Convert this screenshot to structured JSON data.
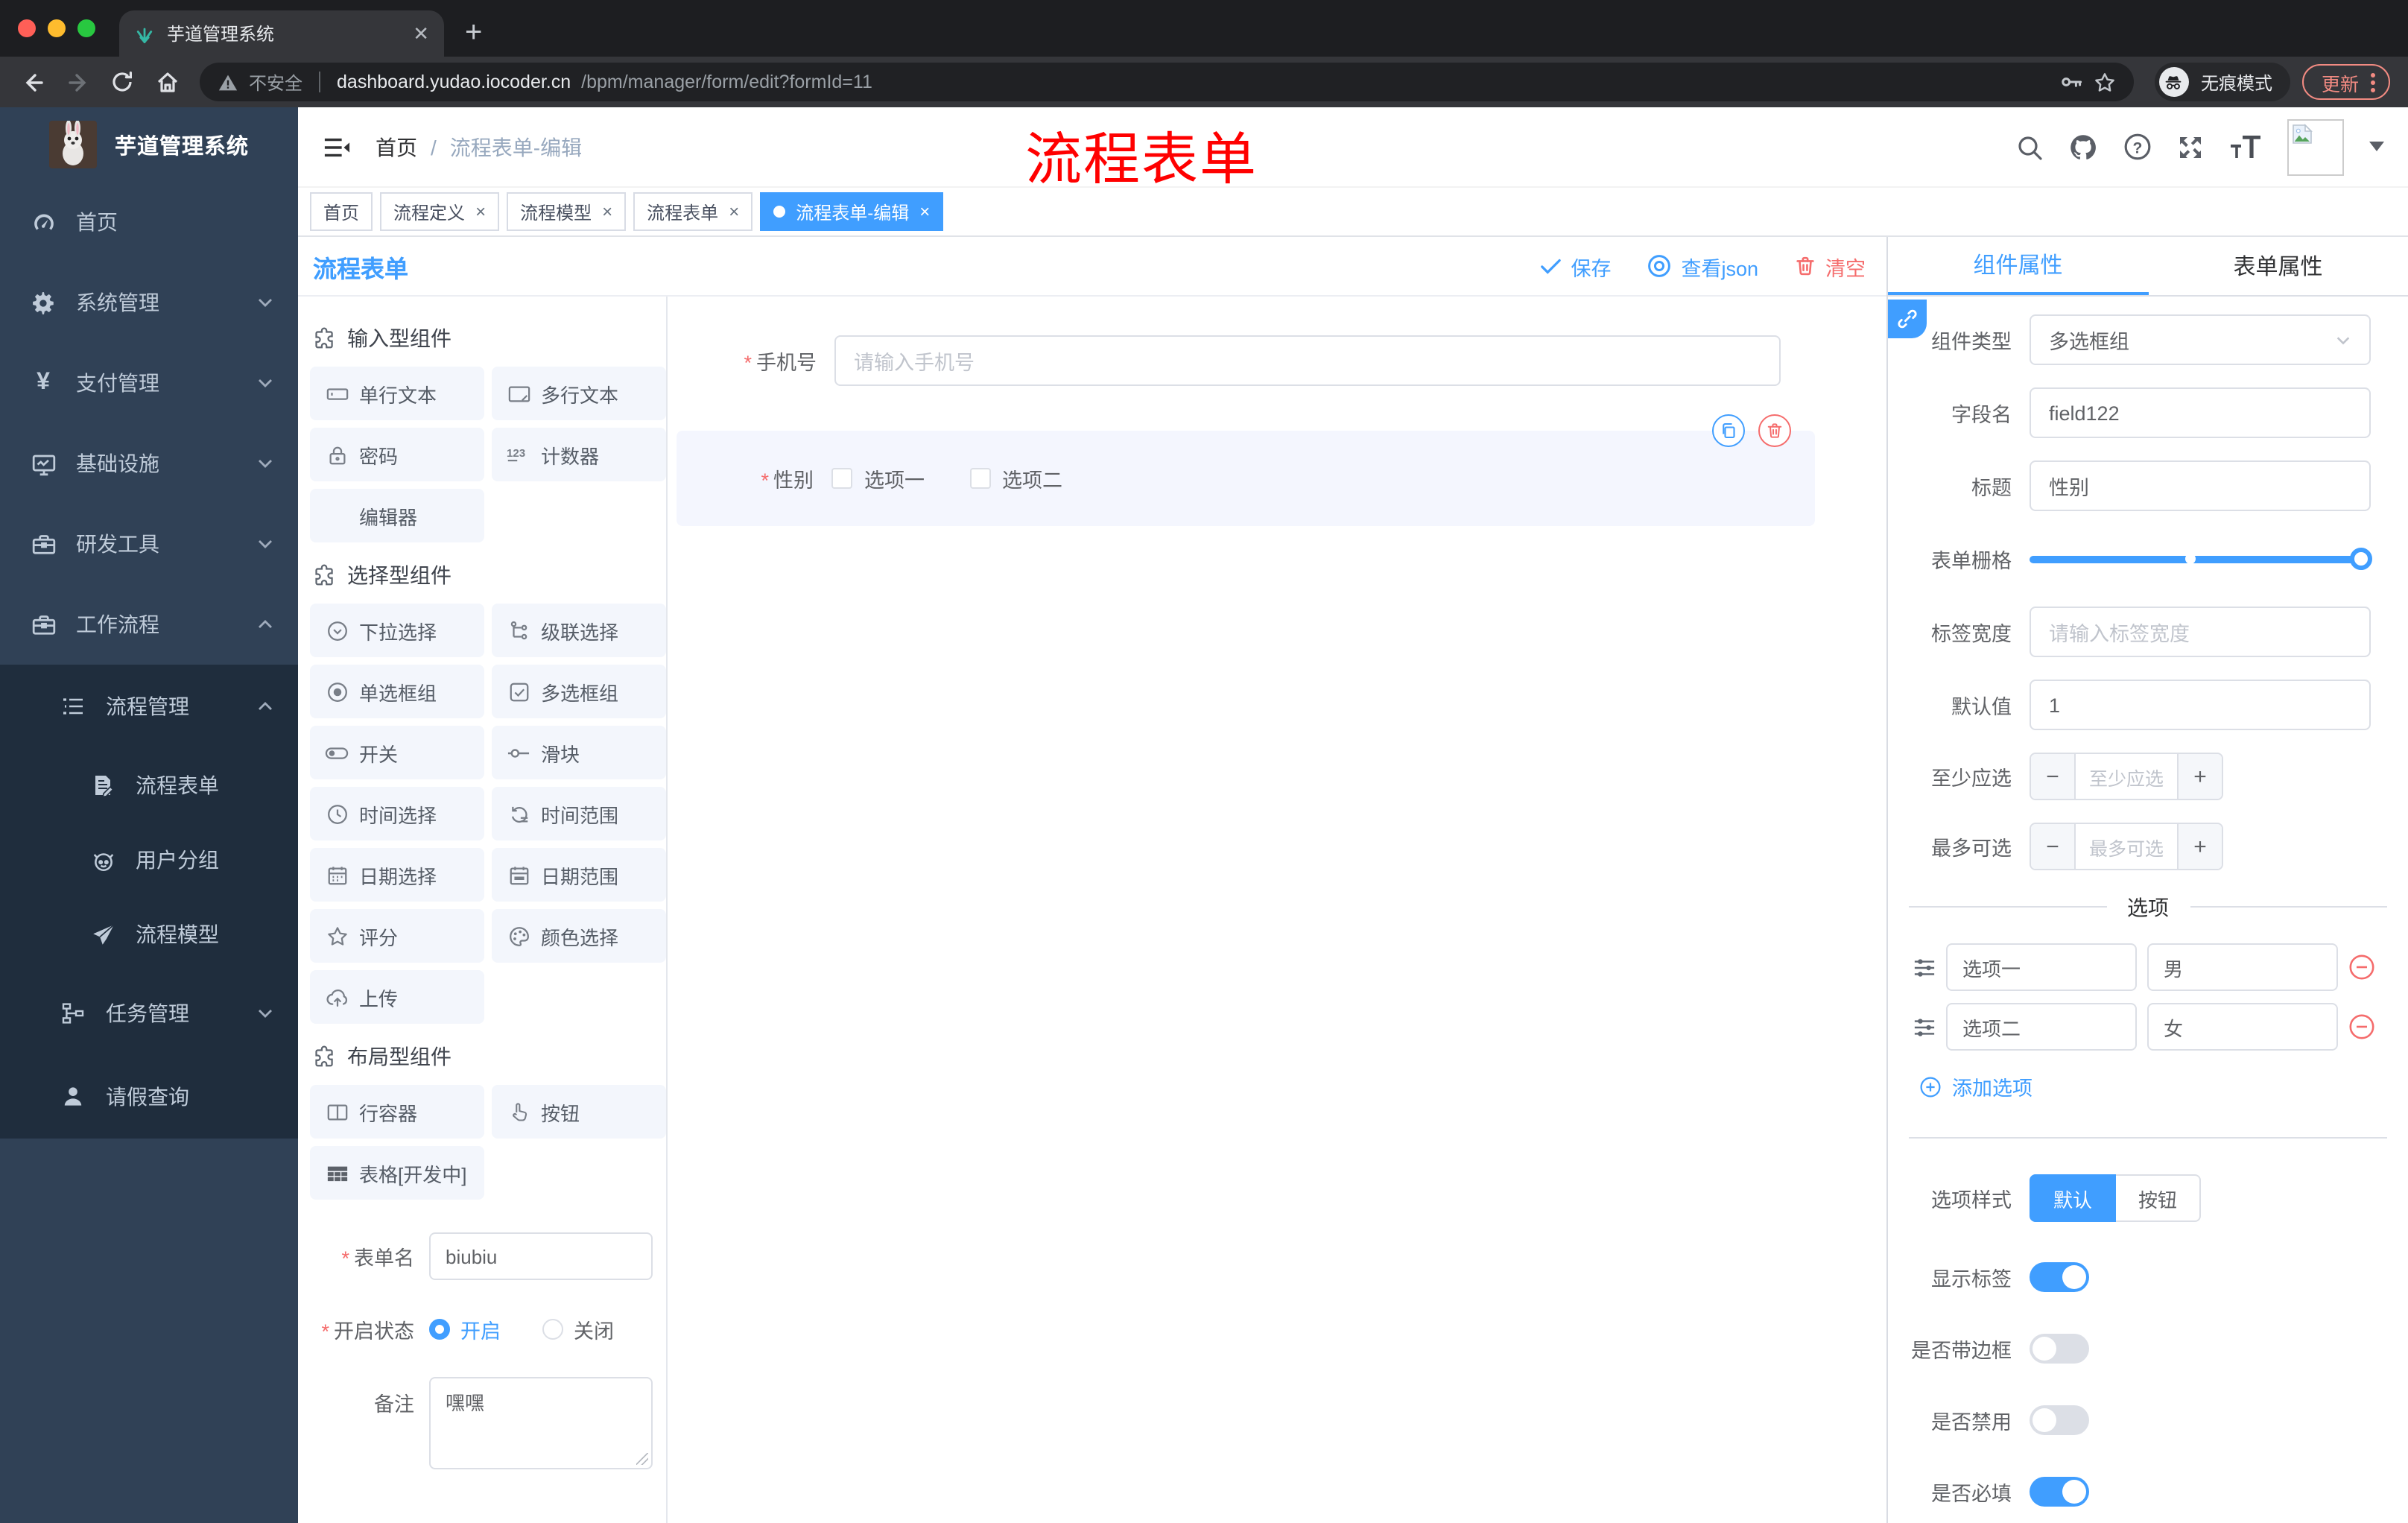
{
  "colors": {
    "primary": "#409eff",
    "danger": "#f56c6c",
    "annotation": "#ff0000",
    "sidebar_bg": "#304156",
    "submenu_bg": "#1f2d3d"
  },
  "browser": {
    "tab_title": "芋道管理系统",
    "security_label": "不安全",
    "url_domain": "dashboard.yudao.iocoder.cn",
    "url_path": "/bpm/manager/form/edit?formId=11",
    "incognito_label": "无痕模式",
    "update_label": "更新"
  },
  "sidebar": {
    "brand": "芋道管理系统",
    "home": "首页",
    "system": "系统管理",
    "payment": "支付管理",
    "infra": "基础设施",
    "devtools": "研发工具",
    "workflow": "工作流程",
    "process_mgmt": "流程管理",
    "process_form": "流程表单",
    "user_group": "用户分组",
    "process_model": "流程模型",
    "task_mgmt": "任务管理",
    "leave_query": "请假查询"
  },
  "navbar": {
    "breadcrumb_home": "首页",
    "breadcrumb_current": "流程表单-编辑",
    "annotation": "流程表单"
  },
  "tags": {
    "home": "首页",
    "process_def": "流程定义",
    "process_model": "流程模型",
    "process_form": "流程表单",
    "active_tag": "流程表单-编辑"
  },
  "builder": {
    "page_title": "流程表单",
    "save": "保存",
    "view_json": "查看json",
    "clear": "清空",
    "palette": {
      "sec_input": "输入型组件",
      "input_items": [
        "单行文本",
        "多行文本",
        "密码",
        "计数器",
        "编辑器"
      ],
      "sec_select": "选择型组件",
      "select_items": [
        "下拉选择",
        "级联选择",
        "单选框组",
        "多选框组",
        "开关",
        "滑块",
        "时间选择",
        "时间范围",
        "日期选择",
        "日期范围",
        "评分",
        "颜色选择",
        "上传"
      ],
      "sec_layout": "布局型组件",
      "layout_items": [
        "行容器",
        "按钮",
        "表格[开发中]"
      ]
    },
    "meta": {
      "form_name_label": "表单名",
      "form_name_value": "biubiu",
      "status_label": "开启状态",
      "status_on": "开启",
      "status_off": "关闭",
      "remark_label": "备注",
      "remark_value": "嘿嘿"
    },
    "canvas": {
      "phone_label": "手机号",
      "phone_placeholder": "请输入手机号",
      "gender_label": "性别",
      "gender_opt1": "选项一",
      "gender_opt2": "选项二"
    }
  },
  "panel": {
    "tab_component": "组件属性",
    "tab_form": "表单属性",
    "component_type_label": "组件类型",
    "component_type_value": "多选框组",
    "field_name_label": "字段名",
    "field_name_value": "field122",
    "title_label": "标题",
    "title_value": "性别",
    "grid_label": "表单栅格",
    "label_width_label": "标签宽度",
    "label_width_placeholder": "请输入标签宽度",
    "default_label": "默认值",
    "default_value": "1",
    "min_label": "至少应选",
    "min_placeholder": "至少应选",
    "max_label": "最多可选",
    "max_placeholder": "最多可选",
    "options_divider": "选项",
    "opt1_label": "选项一",
    "opt1_value": "男",
    "opt2_label": "选项二",
    "opt2_value": "女",
    "add_option": "添加选项",
    "option_style_label": "选项样式",
    "style_default": "默认",
    "style_button": "按钮",
    "show_label_label": "显示标签",
    "border_label": "是否带边框",
    "disabled_label": "是否禁用",
    "required_label": "是否必填"
  }
}
